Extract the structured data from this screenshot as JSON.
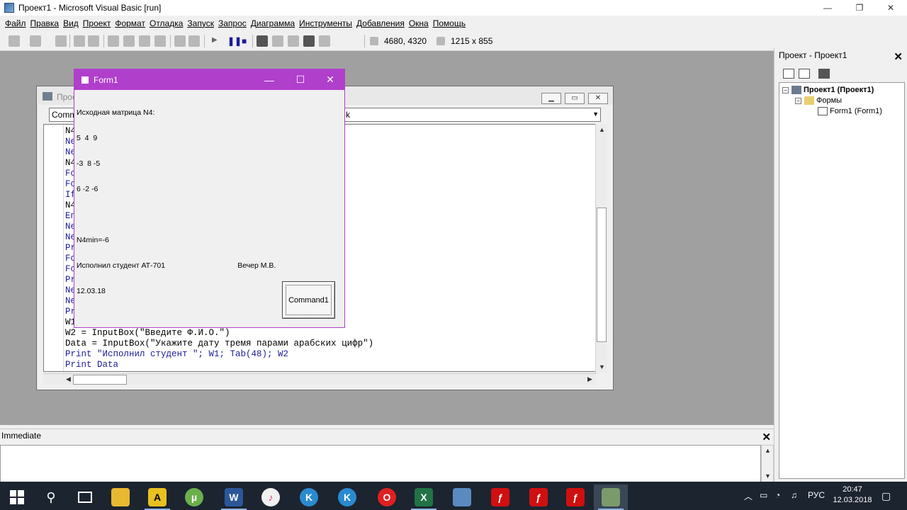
{
  "window": {
    "title": "Проект1 - Microsoft Visual Basic [run]"
  },
  "menu": [
    "Файл",
    "Правка",
    "Вид",
    "Проект",
    "Формат",
    "Отладка",
    "Запуск",
    "Запрос",
    "Диаграмма",
    "Инструменты",
    "Добавления",
    "Окна",
    "Помощь"
  ],
  "toolbar": {
    "position": "4680, 4320",
    "size": "1215 x 855"
  },
  "code_window": {
    "title": "Прое",
    "object_combo": "Comm",
    "proc_combo": "k",
    "lines": [
      {
        "text": "N4",
        "kw": false
      },
      {
        "text": "Ne",
        "kw": true
      },
      {
        "text": "Ne",
        "kw": true
      },
      {
        "text": "N4",
        "kw": false
      },
      {
        "text": "Fo",
        "kw": true
      },
      {
        "text": "Fo",
        "kw": true
      },
      {
        "text": "If",
        "kw": true
      },
      {
        "text": "N4",
        "kw": false
      },
      {
        "text": "En",
        "kw": true
      },
      {
        "text": "Ne",
        "kw": true
      },
      {
        "text": "Ne",
        "kw": true
      },
      {
        "text": "Pr",
        "kw": true
      },
      {
        "text": "Fo",
        "kw": true
      },
      {
        "text": "Fo",
        "kw": true
      },
      {
        "text": "Pr",
        "kw": true
      },
      {
        "text": "Ne",
        "kw": true
      },
      {
        "text": "Ne",
        "kw": true
      },
      {
        "text": "Pr",
        "kw": true
      },
      {
        "text": "W1",
        "kw": false
      },
      {
        "text": "W2 = InputBox(\"Введите Ф.И.О.\")",
        "kw": false
      },
      {
        "text": "Data = InputBox(\"Укажите дату тремя парами арабских цифр\")",
        "kw": false
      },
      {
        "text": "Print \"Исполнил студент \"; W1; Tab(48); W2",
        "kw": true
      },
      {
        "text": "Print Data",
        "kw": true
      }
    ]
  },
  "form1": {
    "title": "Form1",
    "output": [
      "Исходная матрица N4:",
      "5  4  9",
      "-3  8 -5",
      "6 -2 -6",
      "",
      "N4min=-6",
      "Исполнил студент АТ-701                                   Вечер М.В.",
      "12.03.18"
    ],
    "button": "Command1"
  },
  "project_explorer": {
    "title": "Проект - Проект1",
    "project": "Проект1 (Проект1)",
    "folder": "Формы",
    "form": "Form1 (Form1)"
  },
  "immediate": {
    "title": "Immediate"
  },
  "taskbar": {
    "lang": "РУС",
    "time": "20:47",
    "date": "12.03.2018",
    "apps": [
      "file-explorer",
      "archicad",
      "utorrent",
      "word",
      "itunes",
      "kmplayer",
      "kmplayer2",
      "opera",
      "excel",
      "inspector",
      "flash",
      "flash",
      "flash",
      "visual-basic"
    ]
  }
}
